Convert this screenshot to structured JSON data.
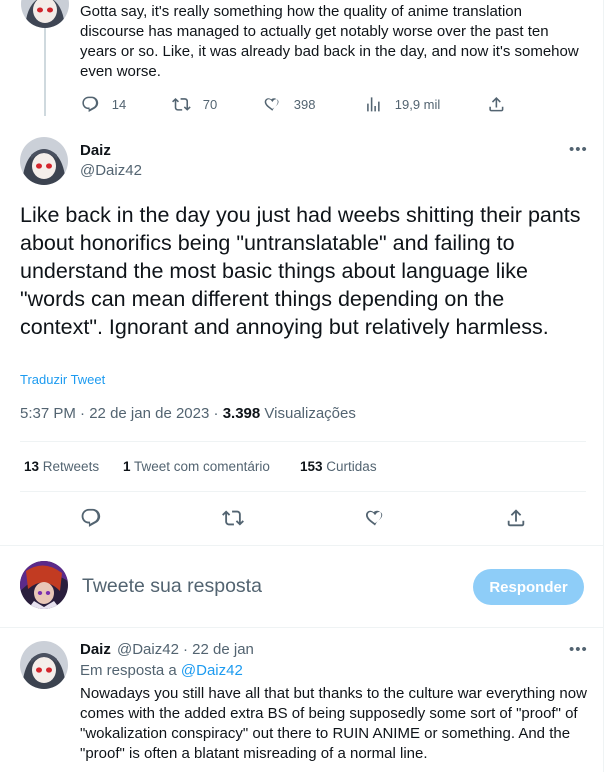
{
  "previous_tweet": {
    "text": "Gotta say, it's really something how the quality of anime translation discourse has managed to actually get notably worse over the past ten years or so. Like, it was already bad back in the day, and now it's somehow even worse.",
    "replies": "14",
    "retweets": "70",
    "likes": "398",
    "views": "19,9 mil"
  },
  "main_tweet": {
    "display_name": "Daiz",
    "handle": "@Daiz42",
    "more": "•••",
    "text": "Like back in the day you just had weebs shitting their pants about honorifics being \"untranslatable\" and failing to understand the most basic things about language like \"words can mean different things depending on the context\". Ignorant and annoying but relatively harmless.",
    "translate_label": "Traduzir Tweet",
    "time": "5:37 PM",
    "date": "22 de jan de 2023",
    "views_count": "3.398",
    "views_label": "Visualizações",
    "sep": "·",
    "stats": {
      "retweets_count": "13",
      "retweets_label": "Retweets",
      "quotes_count": "1",
      "quotes_label": "Tweet com comentário",
      "likes_count": "153",
      "likes_label": "Curtidas"
    }
  },
  "reply_box": {
    "placeholder": "Tweete sua resposta",
    "button_label": "Responder",
    "button_color": "#8ecdf8"
  },
  "reply_tweet": {
    "display_name": "Daiz",
    "handle": "@Daiz42",
    "date": "· 22 de jan",
    "more": "•••",
    "replying_prefix": "Em resposta a",
    "replying_to": "@Daiz42",
    "text": "Nowadays you still have all that but thanks to the culture war everything now comes with the added extra BS of being supposedly some sort of \"proof\" of \"wokalization conspiracy\" out there to RUIN ANIME or something. And the \"proof\" is often a blatant misreading of a normal line."
  },
  "colors": {
    "accent": "#1d9bf0",
    "secondary_text": "#536471",
    "primary_text": "#0f1419"
  },
  "icons": [
    "reply-icon",
    "retweet-icon",
    "like-icon",
    "views-icon",
    "share-icon"
  ]
}
